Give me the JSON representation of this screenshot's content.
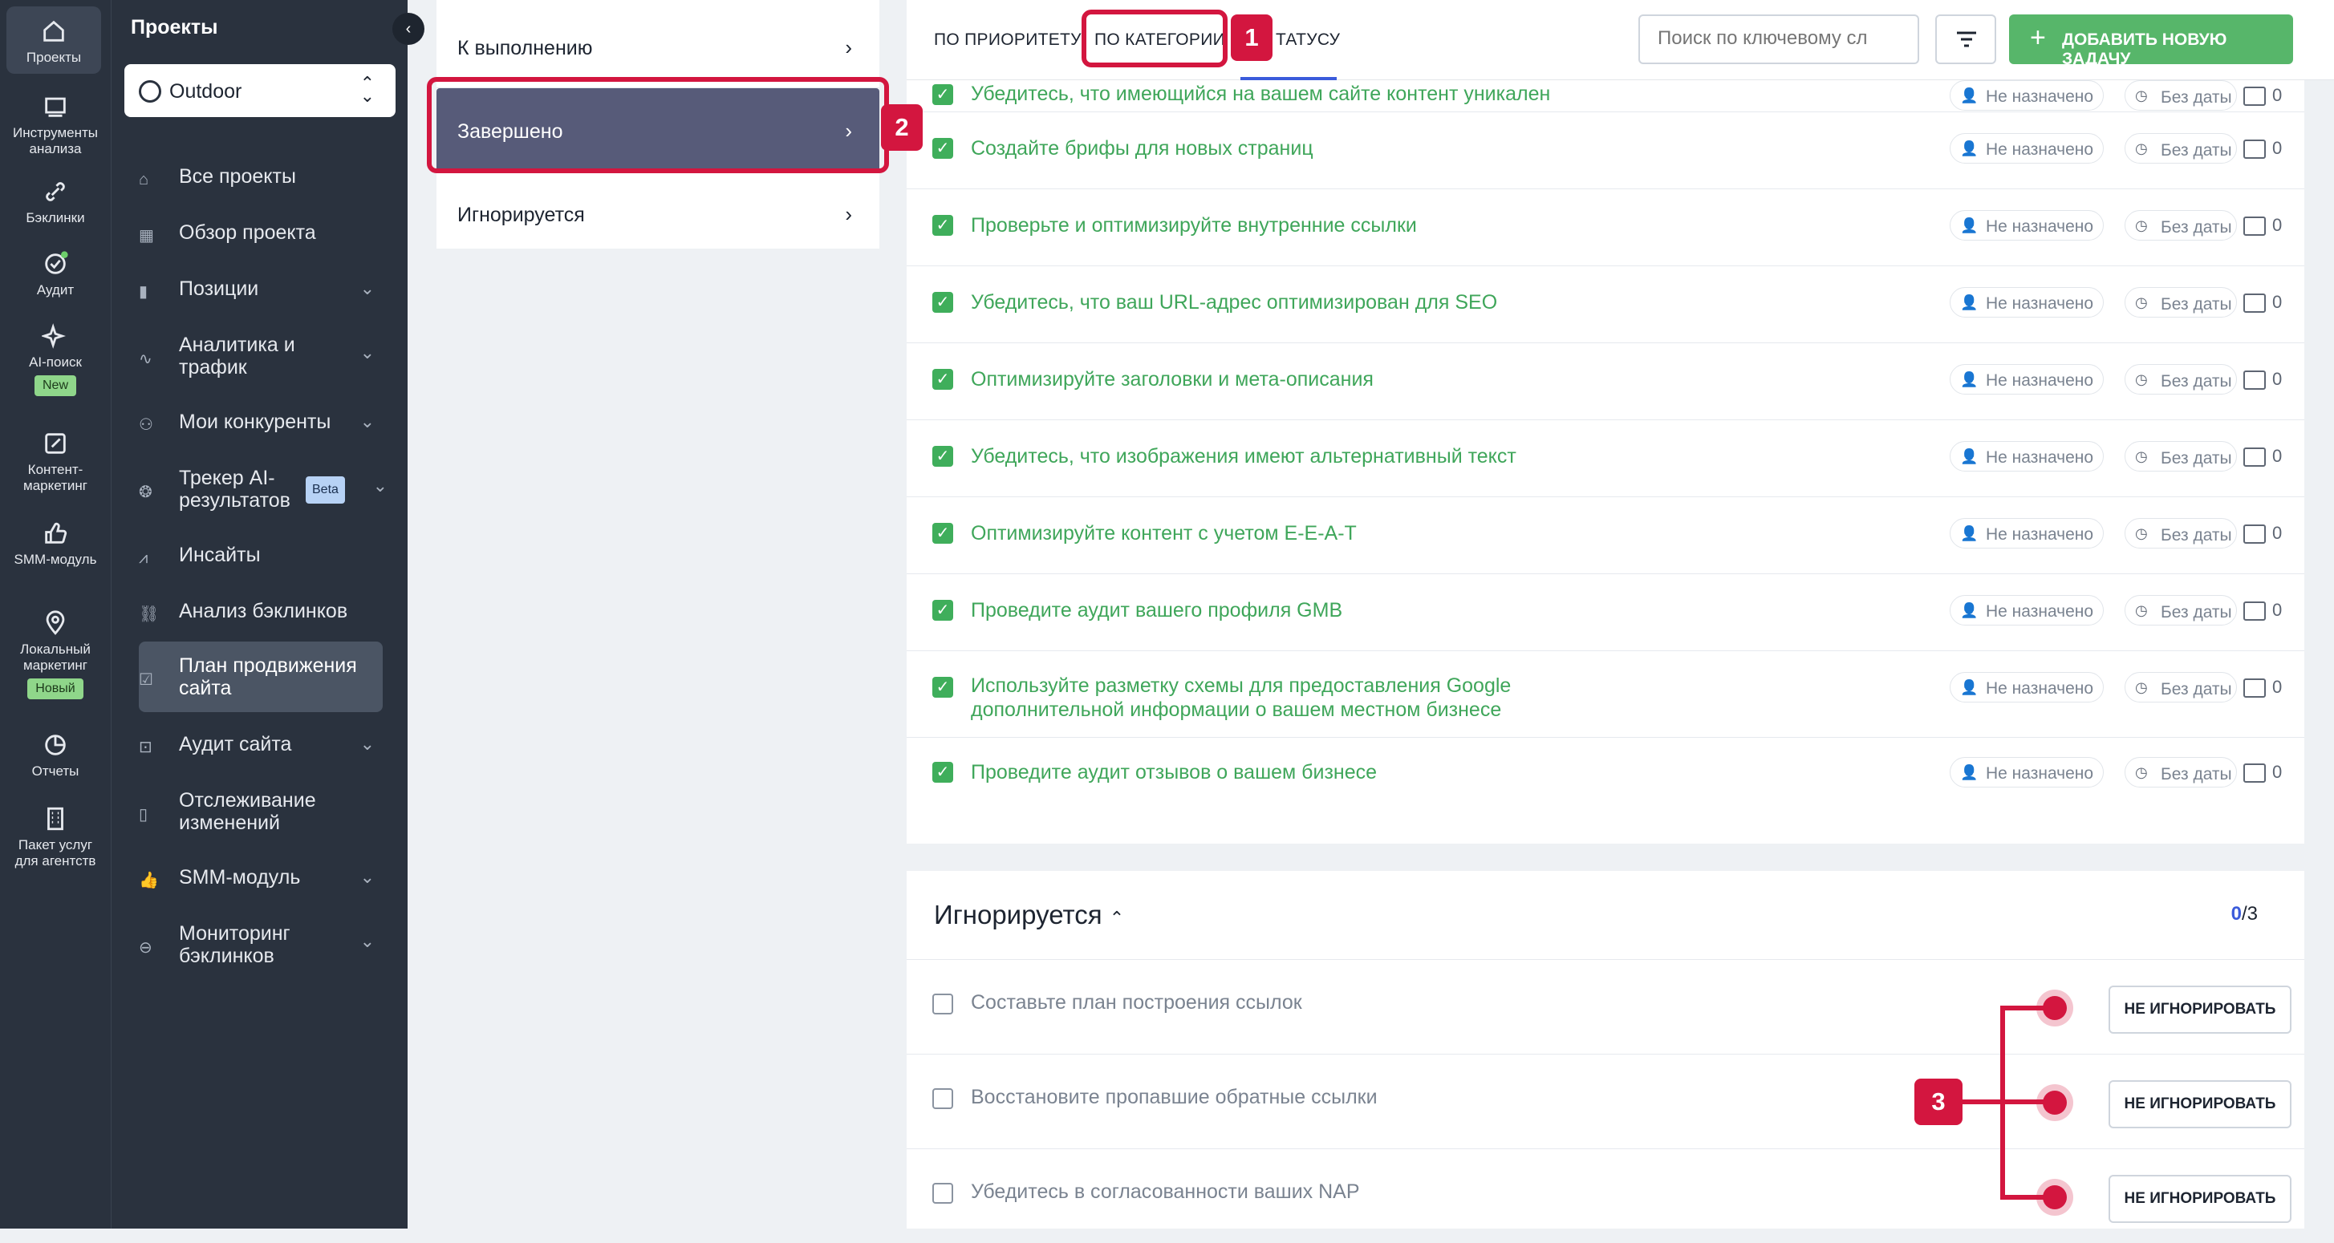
{
  "rail": {
    "items": [
      {
        "icon": "home-icon",
        "label": "Проекты"
      },
      {
        "icon": "analysis-tools-icon",
        "label": "Инструменты анализа"
      },
      {
        "icon": "link-icon",
        "label": "Бэклинки"
      },
      {
        "icon": "audit-icon",
        "label": "Аудит"
      },
      {
        "icon": "sparkle-icon",
        "label": "AI-поиск",
        "badge": "New"
      },
      {
        "icon": "edit-icon",
        "label": "Контент-маркетинг"
      },
      {
        "icon": "thumbs-up-icon",
        "label": "SMM-модуль"
      },
      {
        "icon": "location-pin-icon",
        "label": "Локальный маркетинг",
        "badge": "Новый"
      },
      {
        "icon": "pie-chart-icon",
        "label": "Отчеты"
      },
      {
        "icon": "building-icon",
        "label": "Пакет услуг для агентств"
      }
    ]
  },
  "sidebar": {
    "title": "Проекты",
    "project": "Outdoor",
    "items": [
      {
        "icon": "home-icon",
        "label": "Все проекты",
        "chevron": false
      },
      {
        "icon": "grid-icon",
        "label": "Обзор проекта",
        "chevron": false
      },
      {
        "icon": "bar-chart-icon",
        "label": "Позиции",
        "chevron": true
      },
      {
        "icon": "analytics-icon",
        "label": "Аналитика и трафик",
        "chevron": true
      },
      {
        "icon": "users-icon",
        "label": "Мои конкуренты",
        "chevron": true
      },
      {
        "icon": "ai-tracker-icon",
        "label": "Трекер AI-результатов",
        "badge": "Beta",
        "chevron": true
      },
      {
        "icon": "insights-icon",
        "label": "Инсайты",
        "chevron": false
      },
      {
        "icon": "link-icon",
        "label": "Анализ бэклинков",
        "chevron": false
      },
      {
        "icon": "checklist-icon",
        "label": "План продвижения сайта",
        "chevron": false,
        "active": true
      },
      {
        "icon": "site-audit-icon",
        "label": "Аудит сайта",
        "chevron": true
      },
      {
        "icon": "book-icon",
        "label": "Отслеживание изменений",
        "chevron": false
      },
      {
        "icon": "thumbs-up-icon",
        "label": "SMM-модуль",
        "chevron": true
      },
      {
        "icon": "link-monitor-icon",
        "label": "Мониторинг бэклинков",
        "chevron": true
      }
    ]
  },
  "status_filter": {
    "items": [
      {
        "label": "К выполнению",
        "selected": false
      },
      {
        "label": "Завершено",
        "selected": true
      },
      {
        "label": "Игнорируется",
        "selected": false
      }
    ]
  },
  "header": {
    "tabs": [
      {
        "label": "ПО ПРИОРИТЕТУ"
      },
      {
        "label": "ПО КАТЕГОРИИ"
      },
      {
        "label": "ТАТУСУ"
      }
    ],
    "search_placeholder": "Поиск по ключевому сл",
    "add_task_label": "ДОБАВИТЬ НОВУЮ ЗАДАЧУ"
  },
  "completed_tasks": [
    {
      "label": "Убедитесь, что имеющийся на вашем сайте контент уникален",
      "assignee": "Не назначено",
      "due": "Без даты",
      "comments": "0"
    },
    {
      "label": "Создайте брифы для новых страниц",
      "assignee": "Не назначено",
      "due": "Без даты",
      "comments": "0"
    },
    {
      "label": "Проверьте и оптимизируйте внутренние ссылки",
      "assignee": "Не назначено",
      "due": "Без даты",
      "comments": "0"
    },
    {
      "label": "Убедитесь, что ваш URL-адрес оптимизирован для SEO",
      "assignee": "Не назначено",
      "due": "Без даты",
      "comments": "0"
    },
    {
      "label": "Оптимизируйте заголовки и мета-описания",
      "assignee": "Не назначено",
      "due": "Без даты",
      "comments": "0"
    },
    {
      "label": "Убедитесь, что изображения имеют альтернативный текст",
      "assignee": "Не назначено",
      "due": "Без даты",
      "comments": "0"
    },
    {
      "label": "Оптимизируйте контент с учетом E-E-A-T",
      "assignee": "Не назначено",
      "due": "Без даты",
      "comments": "0"
    },
    {
      "label": "Проведите аудит вашего профиля GMB",
      "assignee": "Не назначено",
      "due": "Без даты",
      "comments": "0"
    },
    {
      "label": "Используйте разметку схемы для предоставления Google дополнительной информации о вашем местном бизнесе",
      "assignee": "Не назначено",
      "due": "Без даты",
      "comments": "0"
    },
    {
      "label": "Проведите аудит отзывов о вашем бизнесе",
      "assignee": "Не назначено",
      "due": "Без даты",
      "comments": "0"
    }
  ],
  "ignored": {
    "title": "Игнорируется",
    "count_done": "0",
    "count_total": "/3",
    "tasks": [
      {
        "label": "Составьте план построения ссылок",
        "button": "НЕ ИГНОРИРОВАТЬ"
      },
      {
        "label": "Восстановите пропавшие обратные ссылки",
        "button": "НЕ ИГНОРИРОВАТЬ"
      },
      {
        "label": "Убедитесь в согласованности ваших NAP",
        "button": "НЕ ИГНОРИРОВАТЬ"
      }
    ]
  },
  "annotations": {
    "badge_1": "1",
    "badge_2": "2",
    "badge_3": "3",
    "color": "#d3163f"
  },
  "colors": {
    "sidebar_bg": "#2a323e",
    "completed_text": "#3fa65a",
    "checkbox_green": "#3fae5b",
    "add_button": "#57b66a",
    "selected_status": "#575b79",
    "accent_blue": "#3b5bdb"
  }
}
